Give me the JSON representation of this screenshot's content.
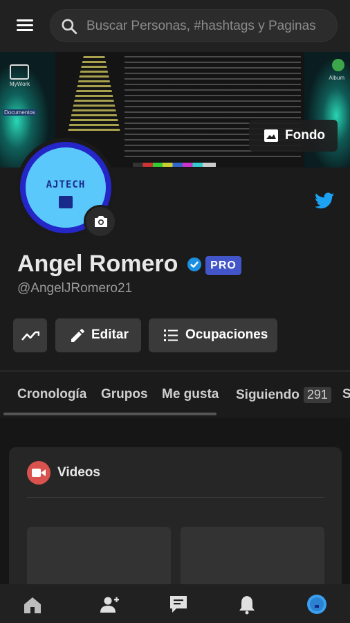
{
  "search": {
    "placeholder": "Buscar Personas, #hashtags y Paginas"
  },
  "cover": {
    "button_label": "Fondo",
    "desktop_labels": [
      "MyWork",
      "Documentos",
      "Album"
    ]
  },
  "avatar": {
    "brand_text": "AJTECH"
  },
  "profile": {
    "name": "Angel Romero",
    "badge": "PRO",
    "handle": "@AngelJRomero21"
  },
  "actions": {
    "edit_label": "Editar",
    "occupations_label": "Ocupaciones"
  },
  "tabs": [
    {
      "label": "Cronología"
    },
    {
      "label": "Grupos"
    },
    {
      "label": "Me gusta"
    },
    {
      "label": "Siguiendo",
      "count": "291"
    },
    {
      "label": "S"
    }
  ],
  "videos_card": {
    "title": "Videos"
  },
  "colors": {
    "background": "#1b1b1b",
    "surface": "#262626",
    "accent_blue": "#2426c8",
    "pro_badge": "#4356c9",
    "twitter": "#1da1f2",
    "video_icon": "#d9524d",
    "nav_active": "#3aa0f2"
  },
  "bottom_nav": {
    "items": [
      "home-icon",
      "add-friend-icon",
      "messages-icon",
      "notifications-icon",
      "profile-icon"
    ],
    "active": "profile-icon"
  }
}
